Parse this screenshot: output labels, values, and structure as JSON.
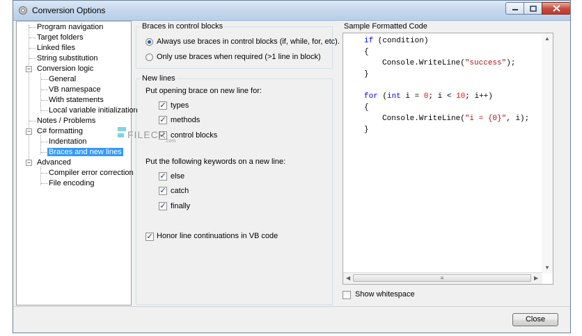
{
  "window": {
    "title": "Conversion Options"
  },
  "tree": [
    {
      "label": "Program navigation"
    },
    {
      "label": "Target folders"
    },
    {
      "label": "Linked files"
    },
    {
      "label": "String substitution"
    },
    {
      "label": "Conversion logic"
    },
    {
      "label": "General"
    },
    {
      "label": "VB namespace"
    },
    {
      "label": "With statements"
    },
    {
      "label": "Local variable initialization"
    },
    {
      "label": "Notes / Problems"
    },
    {
      "label": "C# formatting"
    },
    {
      "label": "Indentation"
    },
    {
      "label": "Braces and new lines"
    },
    {
      "label": "Advanced"
    },
    {
      "label": "Compiler error correction"
    },
    {
      "label": "File encoding"
    }
  ],
  "braces_group": {
    "title": "Braces in control blocks",
    "options": [
      {
        "label": "Always use braces in control blocks (if, while, for, etc).",
        "selected": true
      },
      {
        "label": "Only use braces when required (>1 line in block)",
        "selected": false
      }
    ]
  },
  "newlines_group": {
    "title": "New lines",
    "opening_brace_heading": "Put opening brace on new line for:",
    "opening_brace_items": [
      {
        "label": "types",
        "checked": true
      },
      {
        "label": "methods",
        "checked": true
      },
      {
        "label": "control blocks",
        "checked": true
      }
    ],
    "keywords_heading": "Put the following keywords on a new line:",
    "keyword_items": [
      {
        "label": "else",
        "checked": true
      },
      {
        "label": "catch",
        "checked": true
      },
      {
        "label": "finally",
        "checked": true
      }
    ],
    "honor_line_continuations": {
      "label": "Honor line continuations in VB code",
      "checked": true
    }
  },
  "sample": {
    "title": "Sample Formatted Code",
    "code": {
      "if_keyword": "if",
      "if_condition": " (condition)",
      "open_brace": "{",
      "close_brace": "}",
      "console_call_1": "Console.WriteLine(",
      "success_string": "\"success\"",
      "console_end_1": ");",
      "for_keyword": "for",
      "for_paren_open": " (",
      "int_keyword": "int",
      "for_init": " i = ",
      "zero": "0",
      "for_cond": "; i < ",
      "ten": "10",
      "for_tail": "; i++)",
      "console_call_2": "Console.WriteLine(",
      "format_string": "\"i = {0}\"",
      "console_end_2": ", i);"
    },
    "show_whitespace": {
      "label": "Show whitespace",
      "checked": false
    }
  },
  "buttons": {
    "close": "Close"
  },
  "watermark": {
    "text": "FILECR",
    "sub": ".com"
  }
}
